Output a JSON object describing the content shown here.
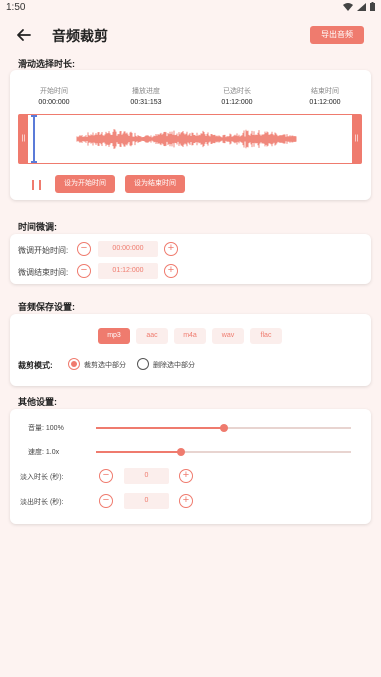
{
  "status": {
    "time": "1:50"
  },
  "appbar": {
    "title": "音频裁剪",
    "export_label": "导出音频"
  },
  "section1": {
    "label": "滑动选择时长:",
    "info": [
      {
        "label": "开始时间",
        "value": "00:00:000"
      },
      {
        "label": "播放进度",
        "value": "00:31:153"
      },
      {
        "label": "已选时长",
        "value": "01:12:000"
      },
      {
        "label": "结束时间",
        "value": "01:12:000"
      }
    ],
    "handle_left": "||",
    "handle_right": "||",
    "set_start_label": "设为开始时间",
    "set_end_label": "设为结束时间"
  },
  "section2": {
    "label": "时间微调:",
    "rows": [
      {
        "label": "微调开始时间:",
        "value": "00:00:000"
      },
      {
        "label": "微调结束时间:",
        "value": "01:12:000"
      }
    ],
    "minus": "−",
    "plus": "+"
  },
  "section3": {
    "label": "音频保存设置:",
    "formats": [
      "mp3",
      "aac",
      "m4a",
      "wav",
      "flac"
    ],
    "selected_format": "mp3",
    "mode_label": "裁剪模式:",
    "mode_options": [
      "裁剪选中部分",
      "删除选中部分"
    ],
    "selected_mode": 0
  },
  "section4": {
    "label": "其他设置:",
    "volume_label": "音量: 100%",
    "volume_value": 0.5,
    "speed_label": "速度: 1.0x",
    "speed_value": 0.333,
    "fade_in_label": "淡入时长 (秒):",
    "fade_in_value": "0",
    "fade_out_label": "淡出时长 (秒):",
    "fade_out_value": "0"
  },
  "colors": {
    "accent": "#ef7b6e",
    "background": "#fdf3f1",
    "cursor": "#5b7bd8"
  }
}
